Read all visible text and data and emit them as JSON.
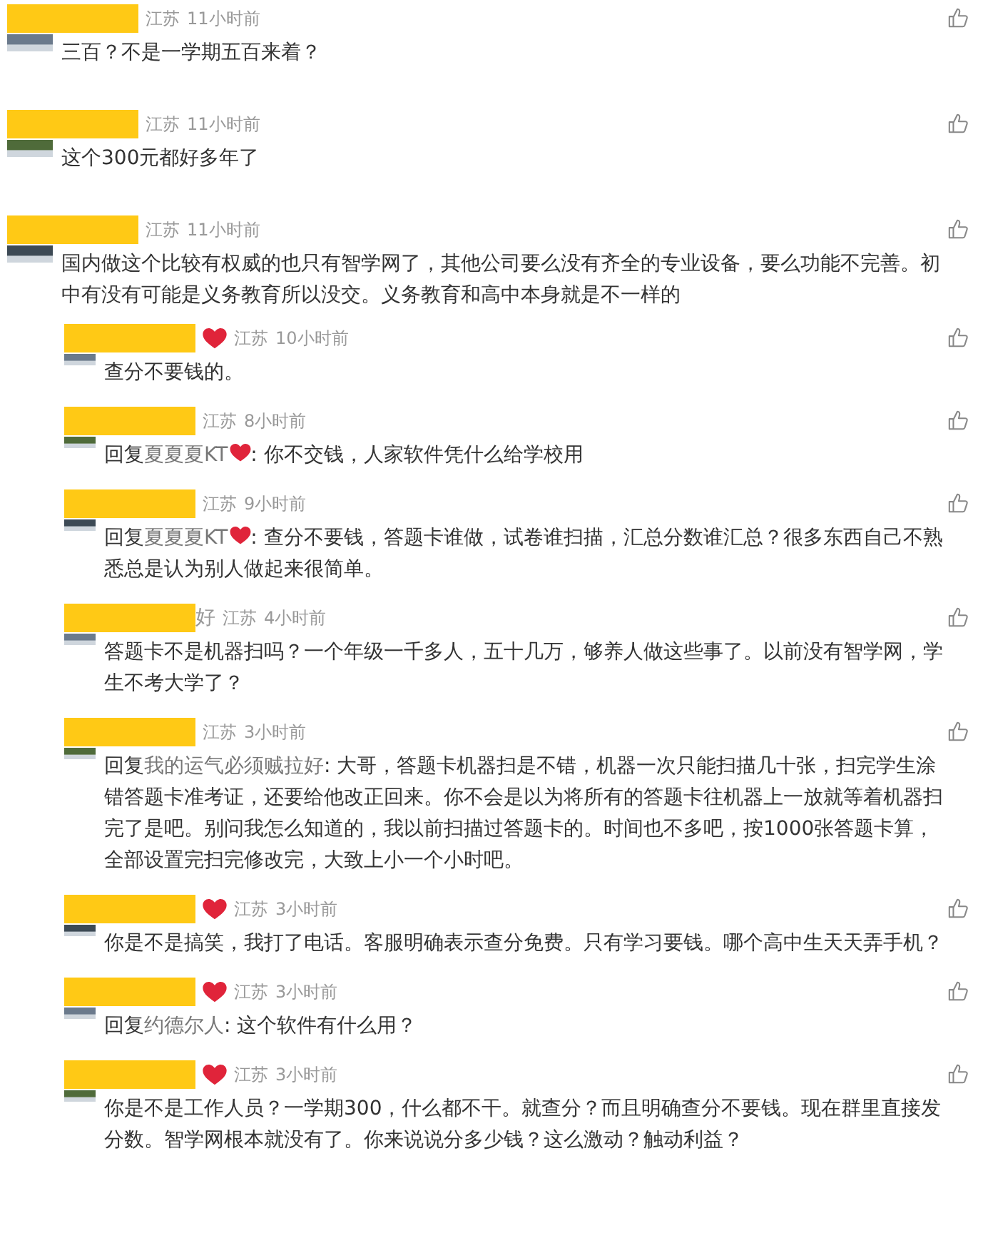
{
  "comments": [
    {
      "kind": "top",
      "location": "江苏",
      "time": "11小时前",
      "text": "三百？不是一学期五百来着？"
    },
    {
      "kind": "top",
      "location": "江苏",
      "time": "11小时前",
      "text": "这个300元都好多年了"
    },
    {
      "kind": "top",
      "location": "江苏",
      "time": "11小时前",
      "text": "国内做这个比较有权威的也只有智学网了，其他公司要么没有齐全的专业设备，要么功能不完善。初中有没有可能是义务教育所以没交。义务教育和高中本身就是不一样的"
    },
    {
      "kind": "reply",
      "heart": true,
      "location": "江苏",
      "time": "10小时前",
      "text": "查分不要钱的。"
    },
    {
      "kind": "reply",
      "location": "江苏",
      "time": "8小时前",
      "reply_label": "回复",
      "reply_to": "夏夏夏KT",
      "reply_heart": true,
      "text": ": 你不交钱，人家软件凭什么给学校用"
    },
    {
      "kind": "reply",
      "location": "江苏",
      "time": "9小时前",
      "reply_label": "回复",
      "reply_to": "夏夏夏KT",
      "reply_heart": true,
      "text": ": 查分不要钱，答题卡谁做，试卷谁扫描，汇总分数谁汇总？很多东西自己不熟悉总是认为别人做起来很简单。"
    },
    {
      "kind": "reply",
      "name_tail": "好",
      "location": "江苏",
      "time": "4小时前",
      "text": "答题卡不是机器扫吗？一个年级一千多人，五十几万，够养人做这些事了。以前没有智学网，学生不考大学了？"
    },
    {
      "kind": "reply",
      "location": "江苏",
      "time": "3小时前",
      "reply_label": "回复",
      "reply_to": "我的运气必须贼拉好",
      "text": ": 大哥，答题卡机器扫是不错，机器一次只能扫描几十张，扫完学生涂错答题卡准考证，还要给他改正回来。你不会是以为将所有的答题卡往机器上一放就等着机器扫完了是吧。别问我怎么知道的，我以前扫描过答题卡的。时间也不多吧，按1000张答题卡算，全部设置完扫完修改完，大致上小一个小时吧。"
    },
    {
      "kind": "reply",
      "heart": true,
      "location": "江苏",
      "time": "3小时前",
      "text": "你是不是搞笑，我打了电话。客服明确表示查分免费。只有学习要钱。哪个高中生天天弄手机？"
    },
    {
      "kind": "reply",
      "heart": true,
      "location": "江苏",
      "time": "3小时前",
      "reply_label": "回复",
      "reply_to": "约德尔人",
      "text": ": 这个软件有什么用？"
    },
    {
      "kind": "reply",
      "heart": true,
      "location": "江苏",
      "time": "3小时前",
      "text": "你是不是工作人员？一学期300，什么都不干。就查分？而且明确查分不要钱。现在群里直接发分数。智学网根本就没有了。你来说说分多少钱？这么激动？触动利益？"
    }
  ]
}
